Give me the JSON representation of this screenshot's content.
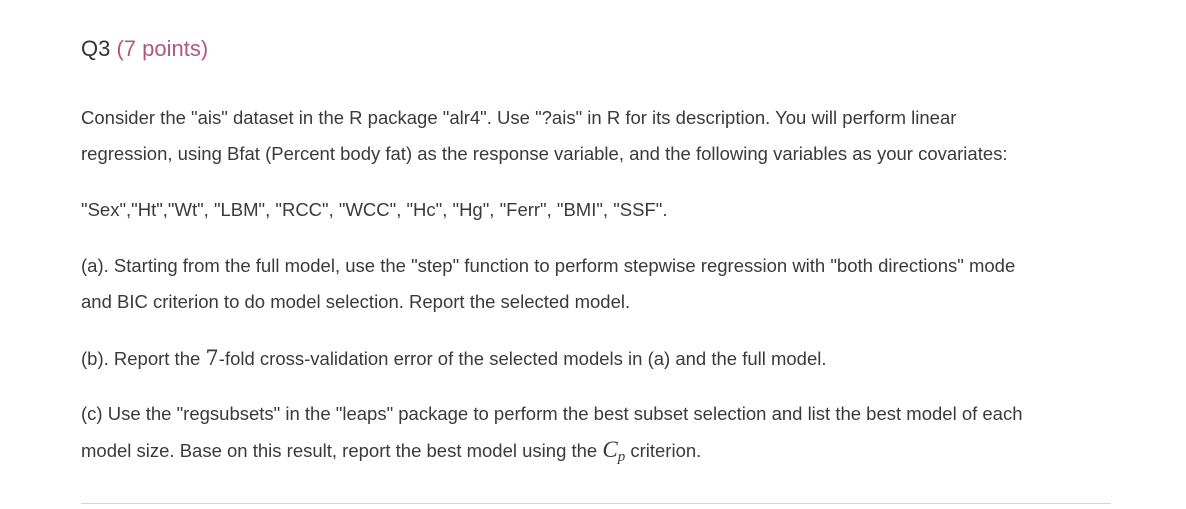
{
  "question": {
    "number": "Q3",
    "points": "(7 points)"
  },
  "intro": {
    "line1": "Consider the \"ais\" dataset in the R package \"alr4\". Use \"?ais\" in R for its description. You will perform linear",
    "line2": "regression, using Bfat (Percent body fat) as the response variable, and the following variables as your covariates:"
  },
  "covariates": "\"Sex\",\"Ht\",\"Wt\", \"LBM\", \"RCC\", \"WCC\", \"Hc\", \"Hg\", \"Ferr\", \"BMI\", \"SSF\".",
  "part_a": {
    "line1": "(a). Starting from the full model, use the \"step\" function to perform stepwise regression with \"both directions\" mode",
    "line2": "and BIC criterion to do model selection. Report the selected model."
  },
  "part_b": {
    "prefix": "(b). Report the ",
    "k": "7",
    "suffix": "-fold cross-validation error of the selected models in (a) and the full model."
  },
  "part_c": {
    "line1": "(c) Use the \"regsubsets\" in the \"leaps\" package to perform the best subset selection and list the best model of each",
    "line2_prefix": "model size. Base on this result, report the best model using the ",
    "cp_main": "C",
    "cp_sub": "p",
    "line2_suffix": " criterion."
  }
}
